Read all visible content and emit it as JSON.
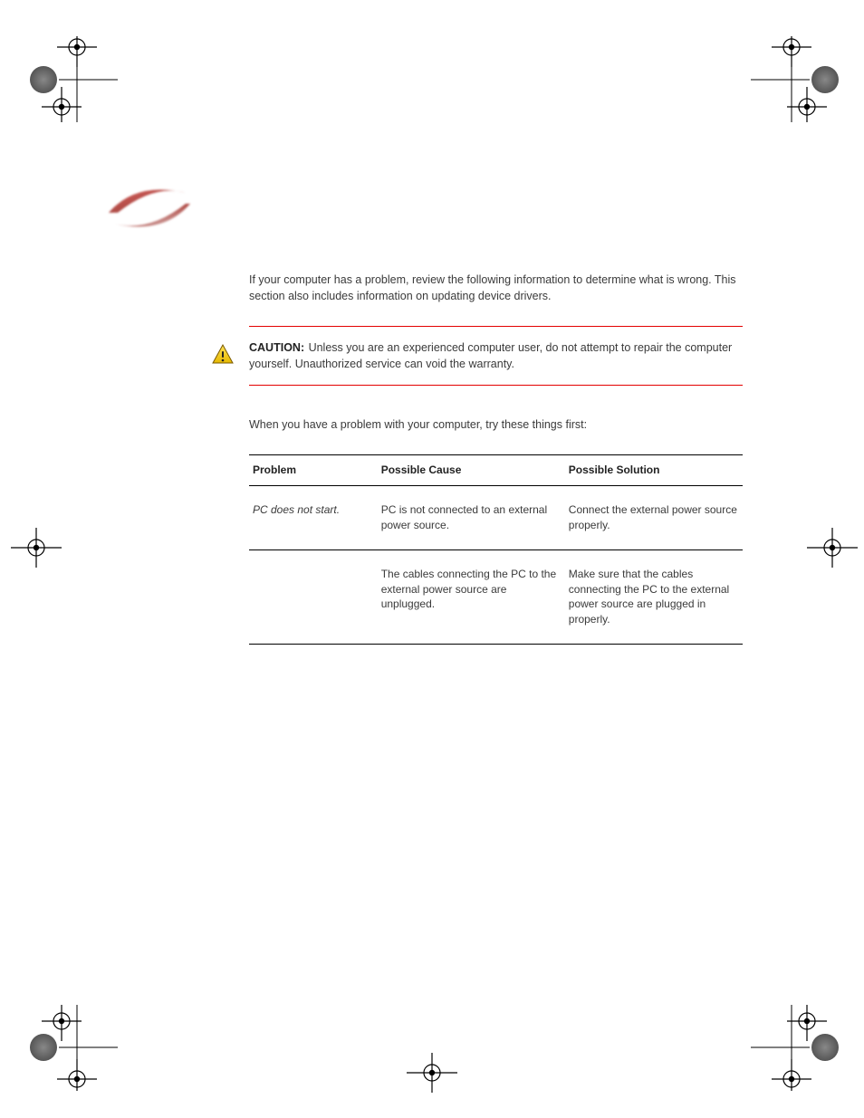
{
  "intro_para": "If your computer has a problem, review the following information to determine what is wrong. This section also includes information on updating device drivers.",
  "caution": {
    "label": "CAUTION:",
    "text": "Unless you are an experienced computer user, do not attempt to repair the computer yourself. Unauthorized service can void the warranty."
  },
  "troubleshoot_para": "When you have a problem with your computer, try these things first:",
  "table": {
    "headers": [
      "Problem",
      "Possible Cause",
      "Possible Solution"
    ],
    "rows": [
      [
        "PC does not start.",
        "PC is not connected to an external power source.",
        "Connect the external power source properly."
      ],
      [
        "",
        "The cables connecting the PC to the external power source are unplugged.",
        "Make sure that the cables connecting the PC to the external power source are plugged in properly."
      ]
    ]
  }
}
